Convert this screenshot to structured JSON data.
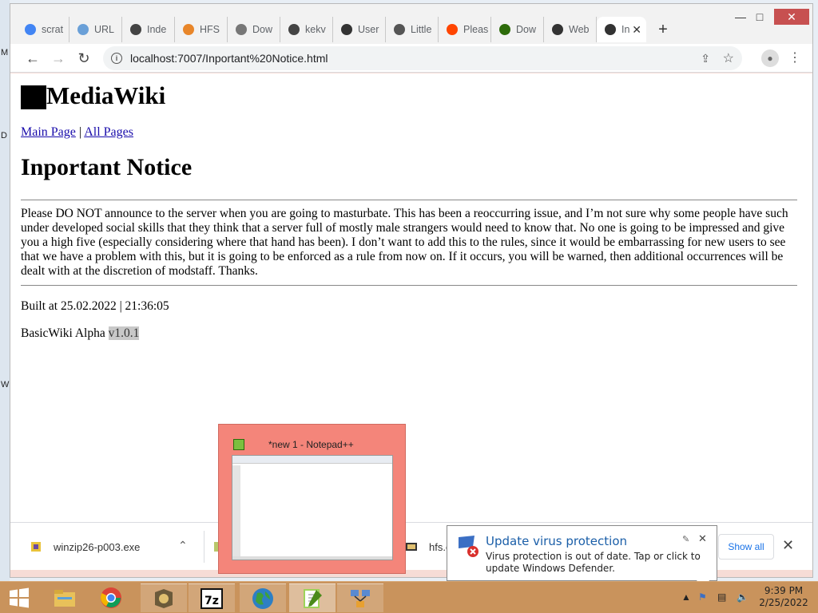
{
  "desktop": {
    "edge_letters": [
      "M",
      "D",
      "W"
    ]
  },
  "browser": {
    "tabs": [
      {
        "label": "scrat",
        "fav": "google-icon",
        "color": "#4285f4"
      },
      {
        "label": "URL",
        "fav": "link-icon",
        "color": "#6aa0d8"
      },
      {
        "label": "Inde",
        "fav": "globe-icon",
        "color": "#444"
      },
      {
        "label": "HFS",
        "fav": "hfs-diamond-icon",
        "color": "#e8862a"
      },
      {
        "label": "Dow",
        "fav": "download-icon",
        "color": "#777"
      },
      {
        "label": "kekv",
        "fav": "globe-icon",
        "color": "#444"
      },
      {
        "label": "User",
        "fav": "hfs-icon",
        "color": "#333"
      },
      {
        "label": "Little",
        "fav": "robot-icon",
        "color": "#555"
      },
      {
        "label": "Pleas",
        "fav": "reddit-icon",
        "color": "#ff4500"
      },
      {
        "label": "Dow",
        "fav": "notepad-icon",
        "color": "#2d6b0a"
      },
      {
        "label": "Web",
        "fav": "bot-icon",
        "color": "#333"
      },
      {
        "label": "In",
        "fav": "hfs-icon",
        "color": "#333",
        "active": true
      }
    ],
    "new_tab_glyph": "+",
    "url": "localhost:7007/Inportant%20Notice.html"
  },
  "page": {
    "site_title": "MediaWiki",
    "nav": {
      "main": "Main Page",
      "sep": "|",
      "all": "All Pages"
    },
    "heading": "Inportant Notice",
    "body": "Please DO NOT announce to the server when you are going to masturbate. This has been a reoccurring issue, and I’m not sure why some people have such under developed social skills that they think that a server full of mostly male strangers would need to know that. No one is going to be impressed and give you a high five (especially considering where that hand has been). I don’t want to add this to the rules, since it would be embarrassing for new users to see that we have a problem with this, but it is going to be enforced as a rule from now on. If it occurs, you will be warned, then additional occurrences will be dealt with at the discretion of modstaff. Thanks.",
    "built": "Built at 25.02.2022 | 21:36:05",
    "version_prefix": "BasicWiki Alpha ",
    "version": "v1.0.1"
  },
  "downloads": {
    "items": [
      {
        "name": "winzip26-p003.exe"
      },
      {
        "name": "hfs.e"
      }
    ],
    "show_all": "Show all"
  },
  "thumbnail": {
    "title": "*new 1 - Notepad++"
  },
  "balloon": {
    "title": "Update virus protection",
    "text": "Virus protection is out of date. Tap or click to update Windows Defender."
  },
  "taskbar": {
    "apps": [
      "file-explorer-icon",
      "chrome-icon",
      "hfs-app-icon",
      "7zip-icon",
      "globe-app-icon",
      "notepadpp-icon",
      "network-app-icon"
    ],
    "active_app": "notepadpp-icon",
    "time": "9:39 PM",
    "date": "2/25/2022"
  },
  "colors": {
    "taskbar": "#c9935c",
    "link": "#1a0dab",
    "balloon_title": "#1a5ea8",
    "thumbnail_bg": "#f4857a"
  }
}
